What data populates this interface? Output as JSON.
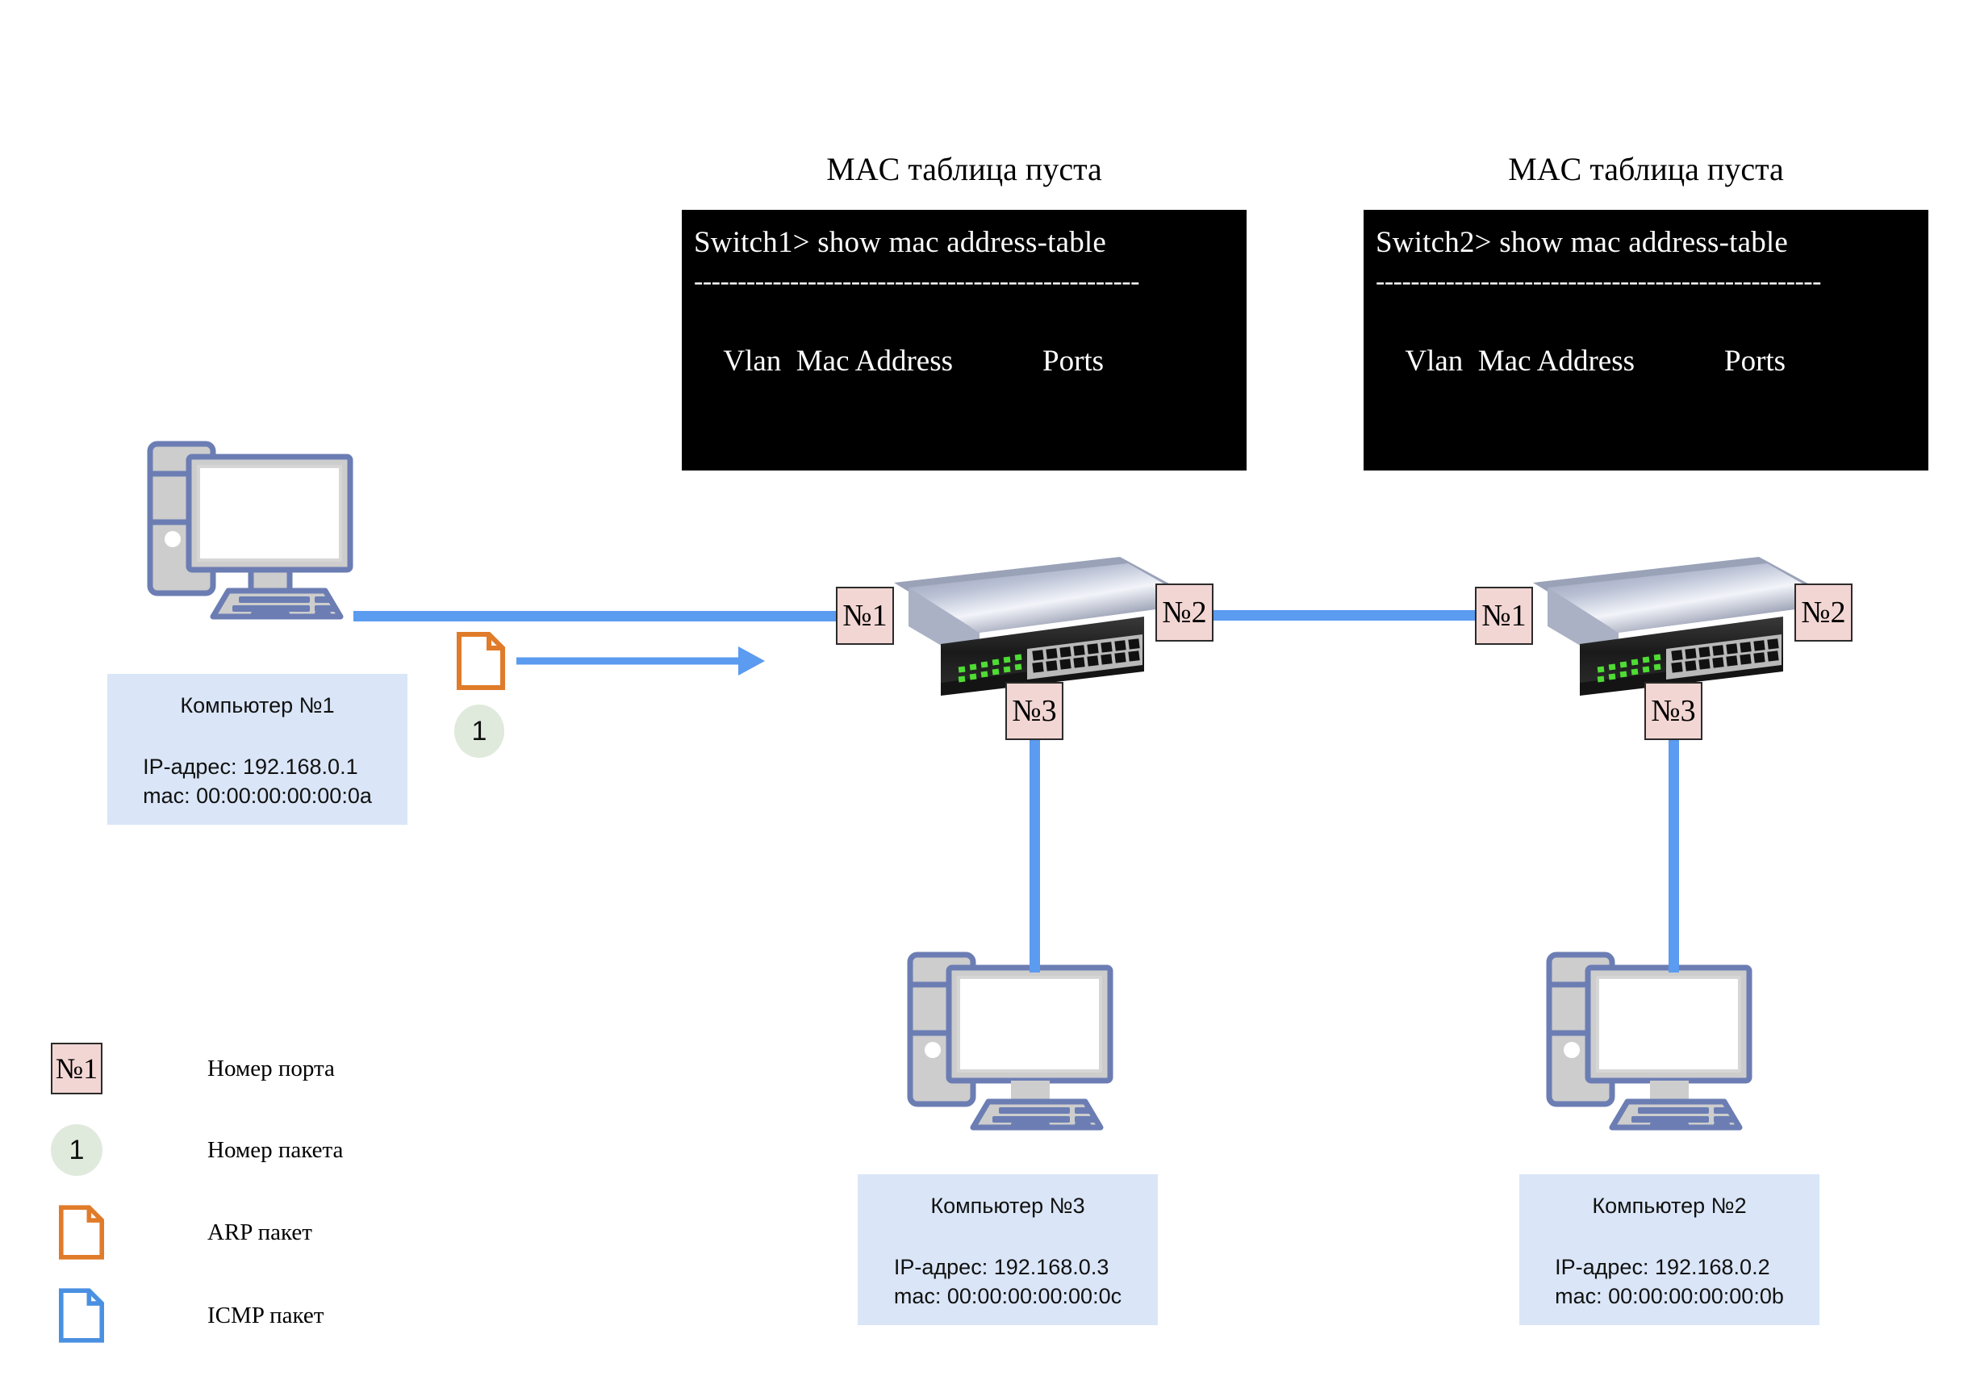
{
  "consoles": [
    {
      "heading": "MAC таблица пуста",
      "prompt": "Switch1> show mac address-table",
      "rule_top": "---------------------------------------------------",
      "col_vlan": "Vlan",
      "col_mac": "Mac Address",
      "col_ports": "Ports",
      "rule_vlan": "------",
      "rule_mac": "------------------------------",
      "rule_ports": "-----------"
    },
    {
      "heading": "MAC таблица пуста",
      "prompt": "Switch2> show mac address-table",
      "rule_top": "---------------------------------------------------",
      "col_vlan": "Vlan",
      "col_mac": "Mac Address",
      "col_ports": "Ports",
      "rule_vlan": "------",
      "rule_mac": "------------------------------",
      "rule_ports": "-----------"
    }
  ],
  "computers": [
    {
      "id": "pc1",
      "title": "Компьютер №1",
      "ip_line": "IP-адрес: 192.168.0.1",
      "mac_line": "mac: 00:00:00:00:00:0a"
    },
    {
      "id": "pc3",
      "title": "Компьютер №3",
      "ip_line": "IP-адрес: 192.168.0.3",
      "mac_line": "mac: 00:00:00:00:00:0c"
    },
    {
      "id": "pc2",
      "title": "Компьютер №2",
      "ip_line": "IP-адрес: 192.168.0.2",
      "mac_line": "mac: 00:00:00:00:00:0b"
    }
  ],
  "switches": [
    {
      "id": "switch1",
      "ports": {
        "p1": "№1",
        "p2": "№2",
        "p3": "№3"
      }
    },
    {
      "id": "switch2",
      "ports": {
        "p1": "№1",
        "p2": "№2",
        "p3": "№3"
      }
    }
  ],
  "packet": {
    "number": "1",
    "type": "arp"
  },
  "legend": {
    "port_chip_text": "№1",
    "port_label": "Номер порта",
    "packet_number_text": "1",
    "packet_number_label": "Номер пакета",
    "arp_label": "ARP пакет",
    "icmp_label": "ICMP пакет"
  },
  "colors": {
    "cable": "#5b9bf0",
    "port_chip_fill": "#f2d6d3",
    "packet_badge_fill": "#dfeadd",
    "infobox_fill": "#dae6f7",
    "arp_outline": "#e07b2a",
    "icmp_outline": "#4a90e2",
    "console_bg": "#000000"
  }
}
